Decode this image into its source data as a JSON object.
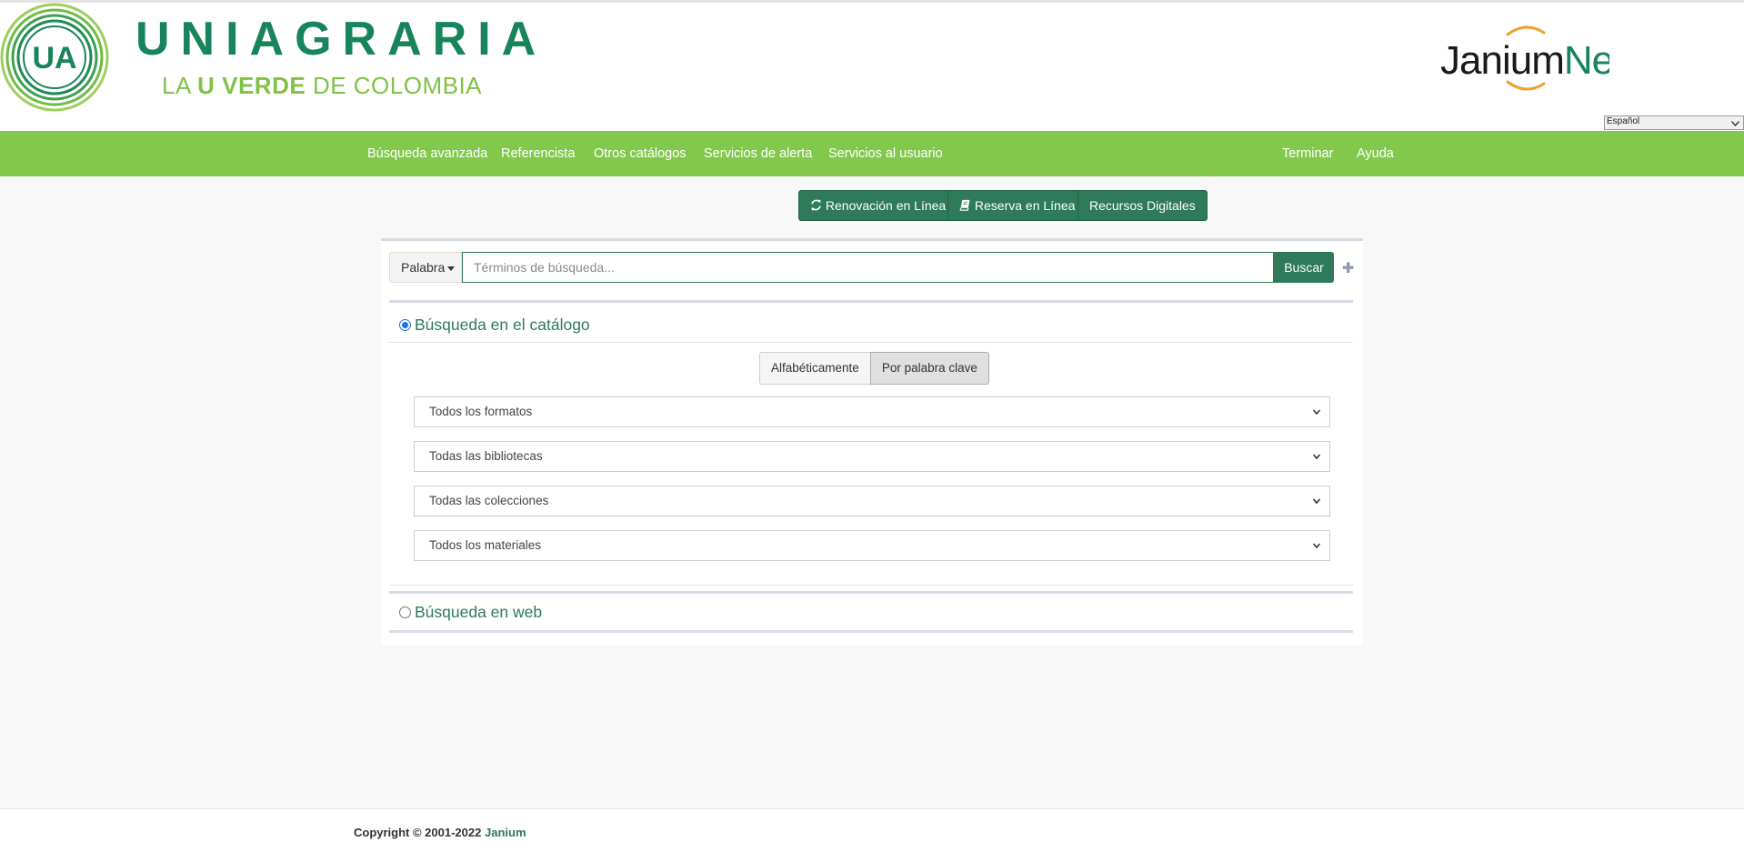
{
  "header": {
    "logo_initials": "UA",
    "logo_name": "UNIAGRARIA",
    "logo_tagline_la": "LA",
    "logo_tagline_u": "U",
    "logo_tagline_verde": "VERDE",
    "logo_tagline_rest": "DE COLOMBIA",
    "brand_janium": "Janium",
    "brand_net": "Net",
    "language_selected": "Español"
  },
  "nav": {
    "items": [
      "Búsqueda avanzada",
      "Referencista",
      "Otros catálogos",
      "Servicios de alerta",
      "Servicios al usuario"
    ],
    "right_items": [
      "Terminar",
      "Ayuda"
    ]
  },
  "quick_links": [
    {
      "label": "Renovación en Línea",
      "icon": "refresh-icon"
    },
    {
      "label": "Reserva en Línea",
      "icon": "book-icon"
    },
    {
      "label": "Recursos Digitales",
      "icon": ""
    }
  ],
  "search": {
    "field_label": "Palabra",
    "placeholder": "Términos de búsqueda...",
    "value": "",
    "button_label": "Buscar"
  },
  "catalog_section": {
    "label": "Búsqueda en el catálogo",
    "selected": true,
    "modes": [
      "Alfabéticamente",
      "Por palabra clave"
    ],
    "active_mode": "Por palabra clave",
    "filters": [
      "Todos los formatos",
      "Todas las bibliotecas",
      "Todas las colecciones",
      "Todos los materiales"
    ]
  },
  "web_section": {
    "label": "Búsqueda en web",
    "selected": false
  },
  "footer": {
    "copyright": "Copyright © 2001-2022",
    "brand": "Janium"
  },
  "colors": {
    "primary_green": "#2e7a5a",
    "nav_green": "#82c84c",
    "logo_green": "#17845b",
    "logo_light_green": "#80c244",
    "janium_orange": "#f0a030"
  }
}
